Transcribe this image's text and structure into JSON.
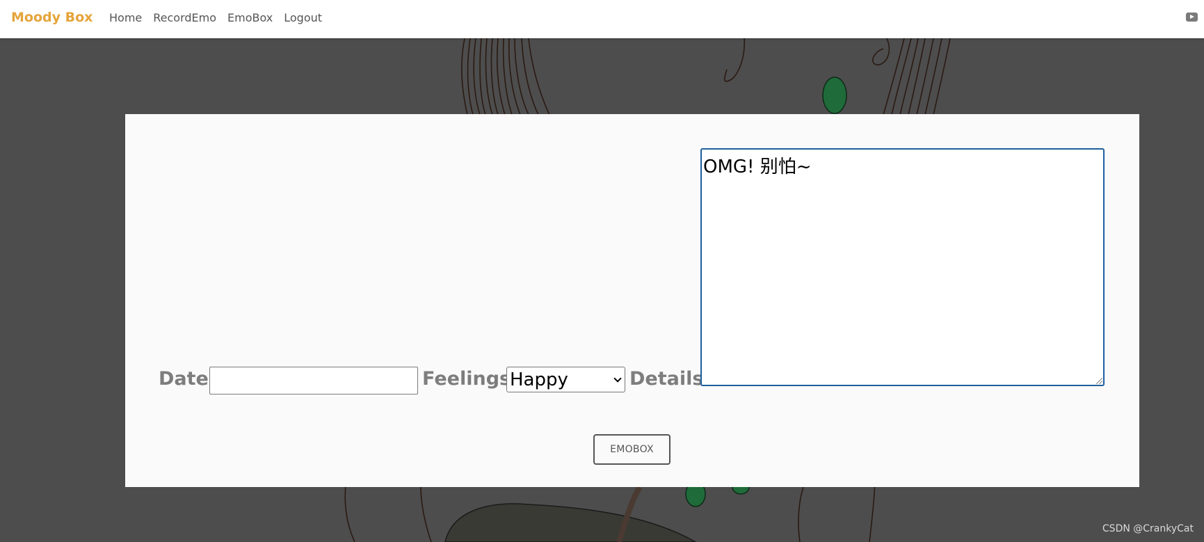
{
  "nav": {
    "brand": "Moody Box",
    "links": [
      "Home",
      "RecordEmo",
      "EmoBox",
      "Logout"
    ],
    "right_icon": "youtube-icon"
  },
  "form": {
    "date_label": "Date:",
    "date_value": "",
    "feelings_label": "Feelings:",
    "feelings_value": "Happy",
    "details_label": "Details:",
    "details_value": "OMG! 别怕~",
    "submit_label": "EMOBOX"
  },
  "watermark": "CSDN @CrankyCat",
  "colors": {
    "brand": "#e5a43a",
    "background": "#4d4d4d",
    "panel": "#fafafa",
    "focus_border": "#1d5f9e",
    "label": "#7d7d7d"
  }
}
